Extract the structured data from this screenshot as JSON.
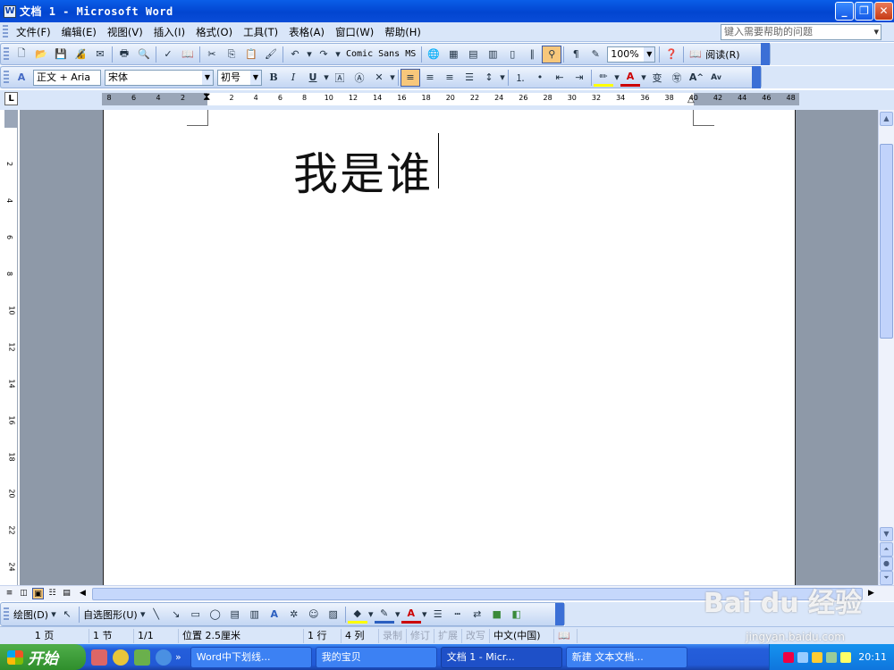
{
  "window": {
    "title": "文档 1 - Microsoft Word",
    "minimize_glyph": "_",
    "maximize_glyph": "❐",
    "close_glyph": "✕"
  },
  "menubar": {
    "items": [
      "文件(F)",
      "编辑(E)",
      "视图(V)",
      "插入(I)",
      "格式(O)",
      "工具(T)",
      "表格(A)",
      "窗口(W)",
      "帮助(H)"
    ],
    "help_placeholder": "键入需要帮助的问题"
  },
  "standard_toolbar": {
    "font_combo": "Comic Sans MS",
    "zoom": "100%",
    "read_label": "阅读(R)"
  },
  "format_toolbar": {
    "style": "正文 + Aria",
    "font": "宋体",
    "size": "初号",
    "bold": "B",
    "italic": "I",
    "underline": "U"
  },
  "ruler": {
    "tab_button": "L",
    "h_ticks": [
      "8",
      "6",
      "4",
      "2",
      "2",
      "4",
      "6",
      "8",
      "10",
      "12",
      "14",
      "16",
      "18",
      "20",
      "22",
      "24",
      "26",
      "28",
      "30",
      "32",
      "34",
      "36",
      "38",
      "40",
      "42",
      "44",
      "46",
      "48"
    ],
    "v_ticks": [
      "2",
      "4",
      "6",
      "8",
      "10",
      "12",
      "14",
      "16",
      "18",
      "20",
      "22",
      "24"
    ]
  },
  "document": {
    "text": "我是谁"
  },
  "drawing_toolbar": {
    "draw_label": "绘图(D)",
    "autoshapes_label": "自选图形(U)"
  },
  "statusbar": {
    "page": "1 页",
    "section": "1 节",
    "page_of": "1/1",
    "position": "位置 2.5厘米",
    "line": "1 行",
    "column": "4 列",
    "rec": "录制",
    "trk": "修订",
    "ext": "扩展",
    "ovr": "改写",
    "language": "中文(中国)"
  },
  "taskbar": {
    "start_label": "开始",
    "tasks": [
      "Word中下划线...",
      "我的宝贝",
      "文档 1 - Micr...",
      "新建 文本文档..."
    ],
    "clock": "20:11"
  },
  "watermark": {
    "brand": "Bai du 经验",
    "url": "jingyan.baidu.com"
  },
  "colors": {
    "titlebar": "#0245d0",
    "toolbar": "#d9e6f9",
    "workspace": "#8e99a8",
    "taskbar": "#245edb",
    "start": "#2f8e2c"
  }
}
